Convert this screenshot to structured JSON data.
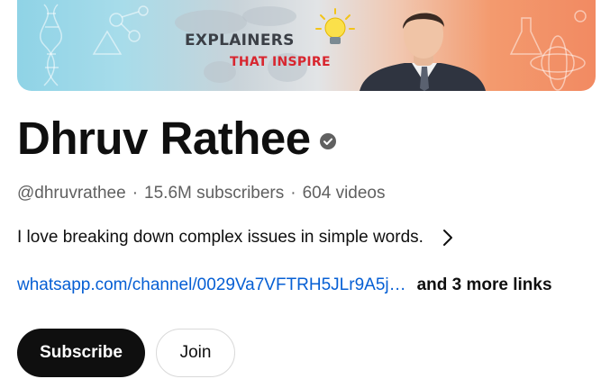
{
  "banner": {
    "title": "EXPLAINERS",
    "subtitle": "THAT INSPIRE",
    "icon": "lightbulb-icon"
  },
  "channel": {
    "name": "Dhruv Rathee",
    "verified_icon": "verified-icon",
    "handle": "@dhruvrathee",
    "separator": "·",
    "subscribers": "15.6M subscribers",
    "videos": "604 videos",
    "description": "I love breaking down complex issues in simple words.",
    "link": "whatsapp.com/channel/0029Va7VFTRH5JLr9A5j…",
    "more_links": "and 3 more links"
  },
  "actions": {
    "subscribe_label": "Subscribe",
    "join_label": "Join"
  },
  "colors": {
    "link": "#065fd4",
    "subscribe_bg": "#0f0f0f",
    "meta_text": "#606060",
    "banner_subtitle": "#d8262f"
  }
}
